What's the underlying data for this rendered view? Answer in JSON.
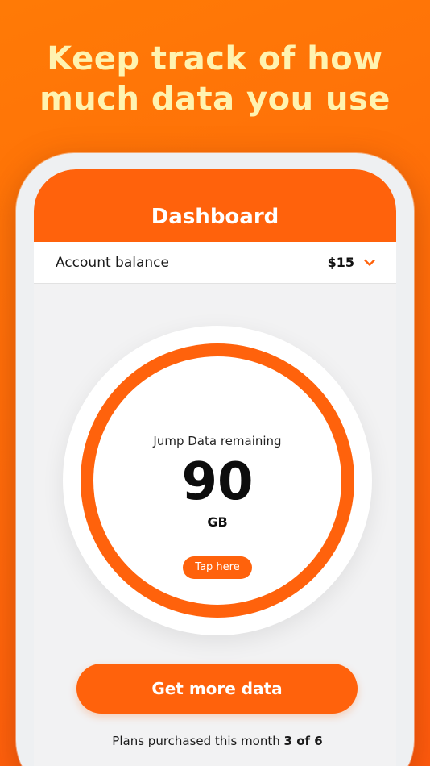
{
  "promo": {
    "headline_line1": "Keep track of how",
    "headline_line2": "much data you use"
  },
  "app": {
    "title": "Dashboard",
    "accent_color": "#ff620c"
  },
  "balance": {
    "label": "Account balance",
    "value": "$15",
    "icon": "chevron-down-icon"
  },
  "data_gauge": {
    "label": "Jump Data remaining",
    "value": "90",
    "unit": "GB",
    "tap_label": "Tap here"
  },
  "cta": {
    "label": "Get more data"
  },
  "plans": {
    "label": "Plans purchased this month",
    "count": "3 of 6"
  }
}
